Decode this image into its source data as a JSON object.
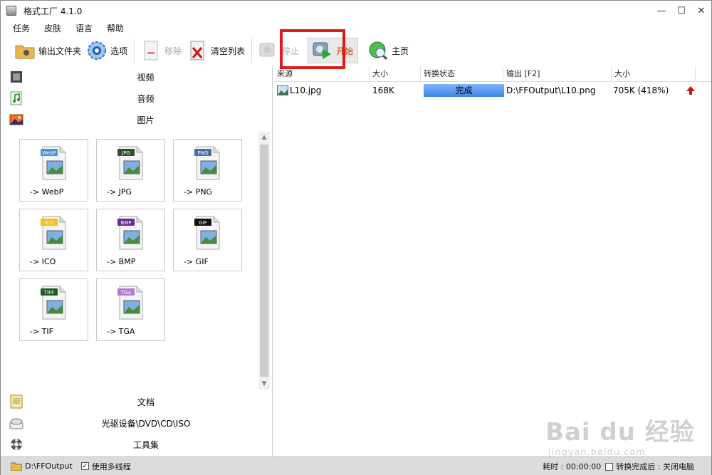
{
  "window": {
    "title": "格式工厂 4.1.0"
  },
  "menu": [
    "任务",
    "皮肤",
    "语言",
    "帮助"
  ],
  "toolbar": {
    "output_folder": "输出文件夹",
    "options": "选项",
    "remove": "移除",
    "clear_list": "清空列表",
    "stop": "停止",
    "start": "开始",
    "home": "主页"
  },
  "categories": {
    "video": "视频",
    "audio": "音频",
    "image": "图片",
    "document": "文档",
    "optical": "光驱设备\\DVD\\CD\\ISO",
    "toolbox": "工具集"
  },
  "formats": [
    {
      "label": "-> WebP",
      "badge": "WebP",
      "color": "#4a90d9"
    },
    {
      "label": "-> JPG",
      "badge": "JPG",
      "color": "#2f4f2f"
    },
    {
      "label": "-> PNG",
      "badge": "PNG",
      "color": "#4a6fa5"
    },
    {
      "label": "-> ICO",
      "badge": "ICO",
      "color": "#f0c020"
    },
    {
      "label": "-> BMP",
      "badge": "BMP",
      "color": "#6a2d8a"
    },
    {
      "label": "-> GIF",
      "badge": "GIF",
      "color": "#111111"
    },
    {
      "label": "-> TIF",
      "badge": "TIFF",
      "color": "#1f5a1f"
    },
    {
      "label": "-> TGA",
      "badge": "TGA",
      "color": "#b07ad0"
    }
  ],
  "table": {
    "headers": [
      "来源",
      "大小",
      "转换状态",
      "输出 [F2]",
      "大小"
    ],
    "rows": [
      {
        "source": "L10.jpg",
        "size": "168K",
        "status": "完成",
        "output": "D:\\FFOutput\\L10.png",
        "out_size": "705K  (418%)"
      }
    ]
  },
  "statusbar": {
    "output_path": "D:\\FFOutput",
    "multithread": "使用多线程",
    "elapsed": "耗时 : 00:00:00",
    "after_done": "转换完成后 : 关闭电脑"
  },
  "watermark": {
    "main": "Bai du 经验",
    "sub": "jingyan.baidu.com"
  },
  "colors": {
    "highlight": "#e01b1b",
    "status_bar_fill": "#3f84e0",
    "start_label": "#cc3300"
  }
}
